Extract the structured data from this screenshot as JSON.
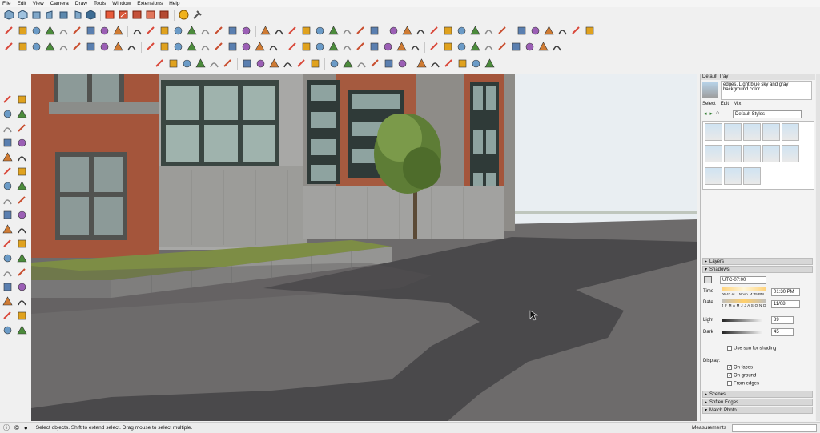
{
  "menu": [
    "File",
    "Edit",
    "View",
    "Camera",
    "Draw",
    "Tools",
    "Window",
    "Extensions",
    "Help"
  ],
  "toolbar_icons": {
    "row1": [
      "views-iso-icon",
      "views-top-icon",
      "views-front-icon",
      "views-right-icon",
      "views-back-icon",
      "views-left-icon",
      "views-bottom-icon",
      "section-plane-icon",
      "section-cut-icon",
      "section-display-icon",
      "section-fill-icon",
      "section-export-icon",
      "info-icon",
      "extension-icon"
    ],
    "row2_count": 60,
    "row3_count": 44,
    "row4_count": 27
  },
  "tray": {
    "title": "Default Tray",
    "style_description": "edges. Light blue sky and gray background color.",
    "tabs": [
      "Select",
      "Edit",
      "Mix"
    ],
    "style_dropdown": "Default Styles",
    "sections": {
      "layers": "Layers",
      "shadows": "Shadows",
      "scenes": "Scenes",
      "soften_edges": "Soften Edges",
      "match_photo": "Match Photo"
    },
    "shadows": {
      "timezone": "UTC-07:00",
      "time_label": "Time",
      "time_start": "06:43 AI",
      "time_noon": "Noon",
      "time_end": "4:45 PM",
      "time_value": "01:30 PM",
      "date_label": "Date",
      "months": "J F M A M J J A S O N D",
      "date_value": "11/08",
      "light_label": "Light",
      "light_value": "89",
      "dark_label": "Dark",
      "dark_value": "45",
      "use_sun": "Use sun for shading",
      "display_label": "Display:",
      "on_faces": "On faces",
      "on_ground": "On ground",
      "from_edges": "From edges"
    }
  },
  "status": {
    "message": "Select objects. Shift to extend select. Drag mouse to select multiple.",
    "measurements_label": "Measurements"
  },
  "colors": {
    "ground": "#6d6b6b",
    "shadow": "#4a494b",
    "sky": "#e8edf1",
    "brick": "#a4553b",
    "grass": "#7d8d45"
  }
}
